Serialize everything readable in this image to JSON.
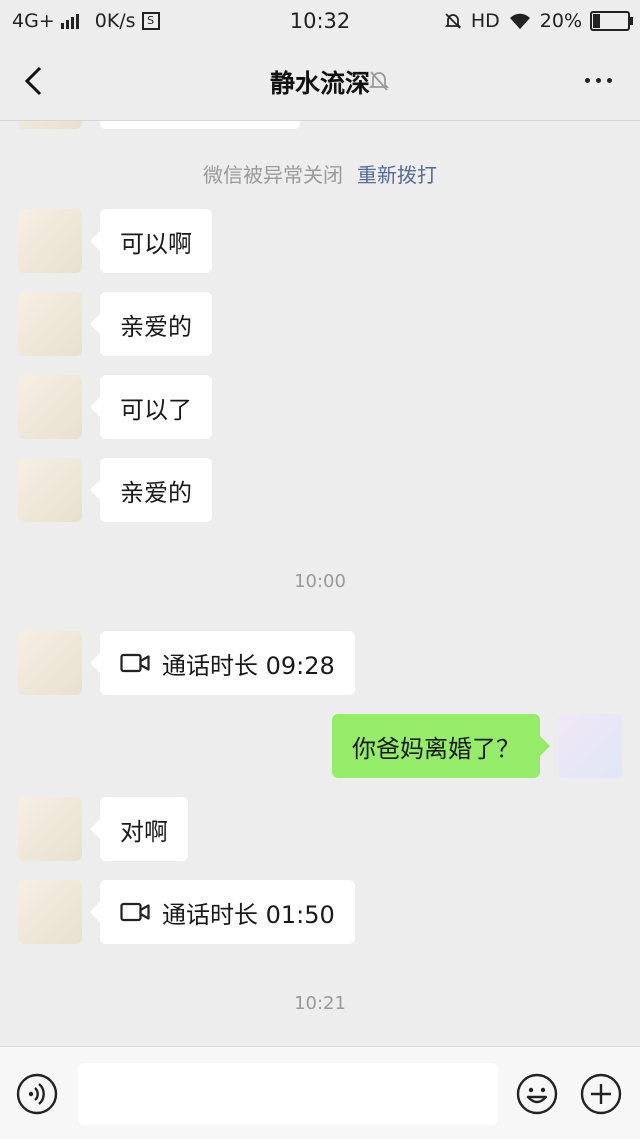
{
  "status_bar": {
    "network": "4G+",
    "speed": "0K/s",
    "s_icon": "S",
    "time": "10:32",
    "hd": "HD",
    "battery": "20%",
    "battery_level": 0.2
  },
  "header": {
    "title": "静水流深",
    "icons": [
      "back-icon",
      "mute-bell-icon",
      "more-icon"
    ]
  },
  "chat": {
    "system_message": {
      "text": "微信被异常关闭",
      "action": "重新拨打"
    },
    "messages_1": [
      {
        "side": "left",
        "text": "可以啊"
      },
      {
        "side": "left",
        "text": "亲爱的"
      },
      {
        "side": "left",
        "text": "可以了"
      },
      {
        "side": "left",
        "text": "亲爱的"
      }
    ],
    "timestamp_1": "10:00",
    "call_1": {
      "label": "通话时长 09:28",
      "icon": "video-call-icon"
    },
    "own_message": "你爸妈离婚了？",
    "reply": "对啊",
    "call_2": {
      "label": "通话时长 01:50",
      "icon": "video-call-icon"
    },
    "timestamp_2": "10:21"
  },
  "input_bar": {
    "value": "",
    "icons": [
      "voice-icon",
      "emoji-icon",
      "plus-icon"
    ]
  },
  "colors": {
    "background": "#ededed",
    "own_bubble": "#95ec69",
    "other_bubble": "#ffffff",
    "link": "#576b95"
  }
}
